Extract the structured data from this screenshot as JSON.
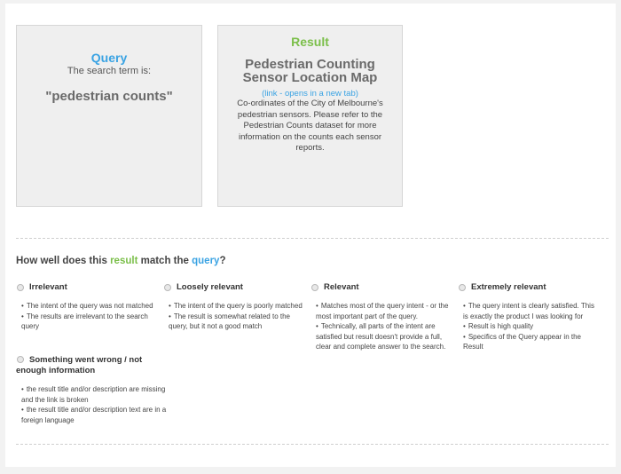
{
  "query": {
    "heading": "Query",
    "subtitle": "The search term is:",
    "term": "\"pedestrian counts\""
  },
  "result": {
    "heading": "Result",
    "title": "Pedestrian Counting Sensor Location Map",
    "link": "(link - opens in a new tab)",
    "description": "Co-ordinates of the City of Melbourne's pedestrian sensors. Please refer to the Pedestrian Counts dataset for more information on the counts each sensor reports."
  },
  "question": {
    "prefix": "How well does this ",
    "result_word": "result",
    "middle": " match the ",
    "query_word": "query",
    "suffix": "?"
  },
  "options": [
    {
      "label": "Irrelevant",
      "bullets": [
        "The intent of the query was not matched",
        "The results are irrelevant to the search query"
      ]
    },
    {
      "label": "Loosely relevant",
      "bullets": [
        "The intent of the query is poorly matched",
        "The result is somewhat related to the query, but it not a good match"
      ]
    },
    {
      "label": "Relevant",
      "bullets": [
        "Matches most of the query intent - or the most important part of the query.",
        "Technically, all parts of the intent are satisfied but result doesn't provide a full, clear and complete answer to the search."
      ]
    },
    {
      "label": "Extremely relevant",
      "bullets": [
        "The query intent is clearly satisfied. This is exactly the product I was looking for",
        "Result is high quality",
        "Specifics of the Query appear in the Result"
      ]
    },
    {
      "label": "Something went wrong / not enough information",
      "bullets": [
        "the result title and/or description are missing and the link is broken",
        "the result title and/or description text are in a foreign language"
      ]
    }
  ]
}
